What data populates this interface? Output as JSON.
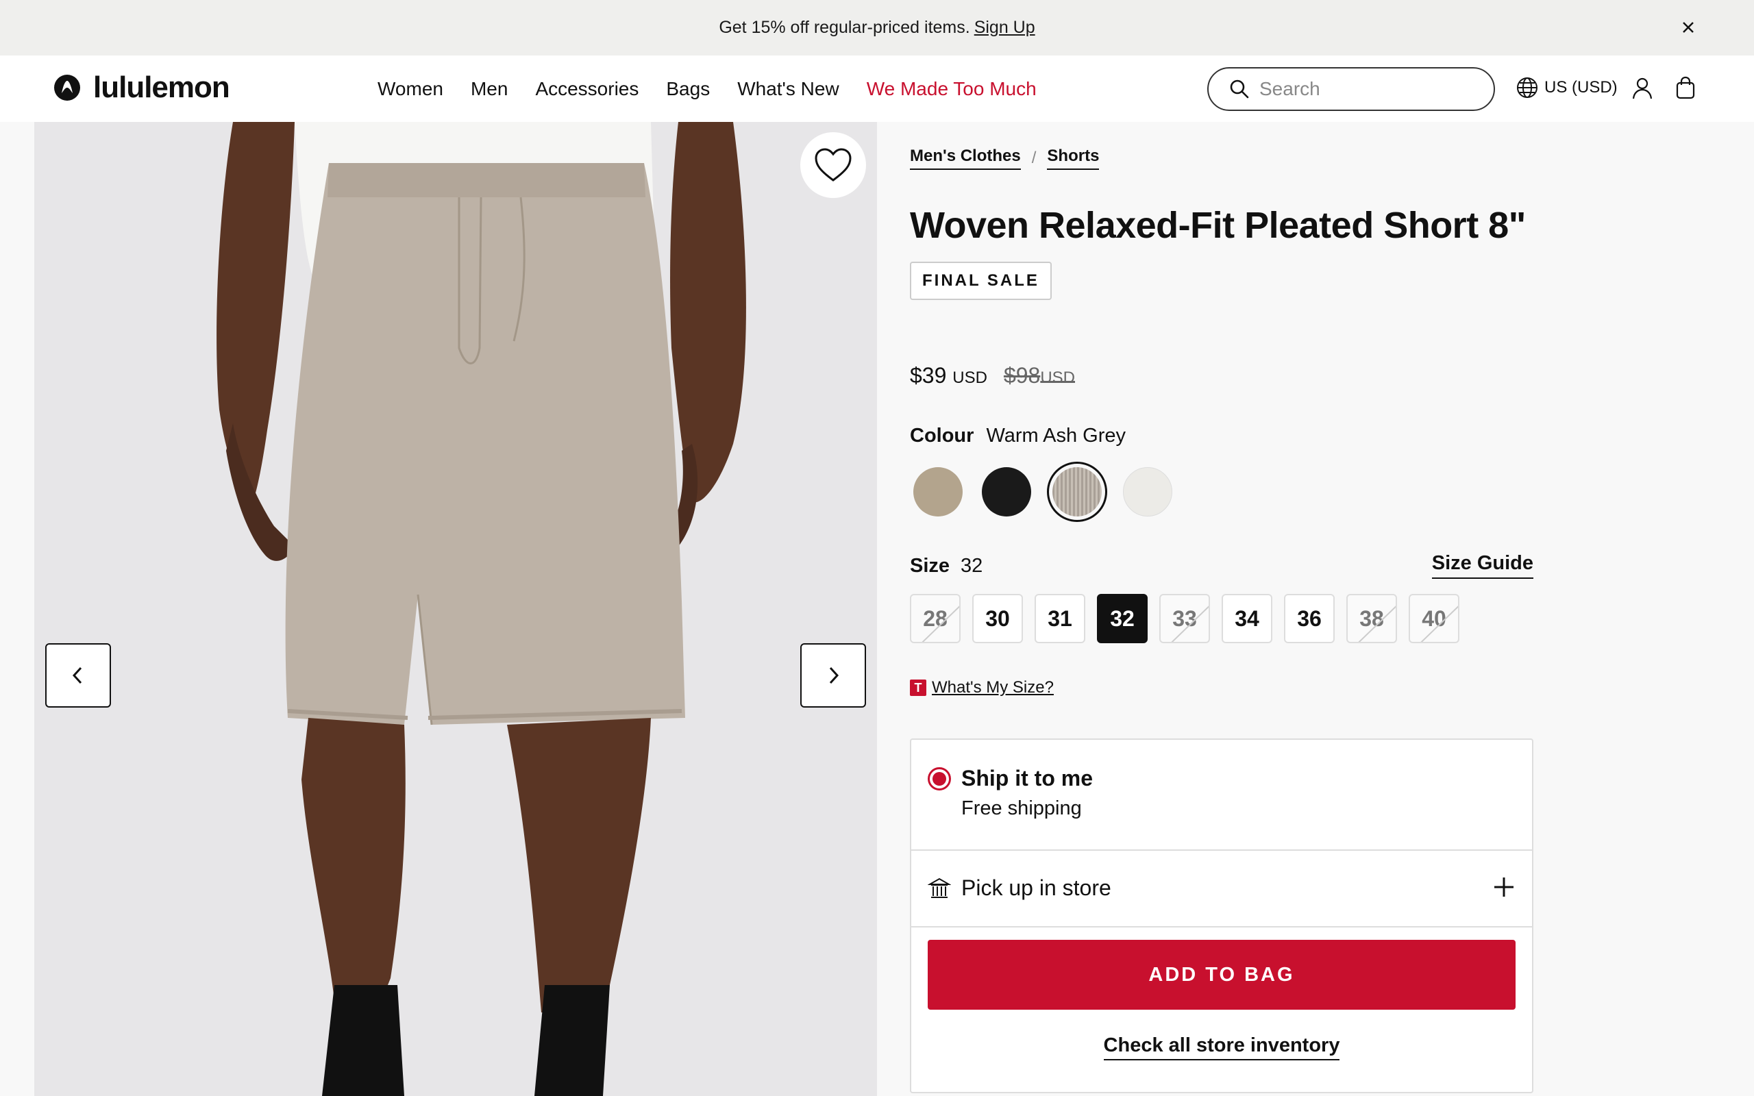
{
  "promo": {
    "text": "Get 15% off regular-priced items.",
    "link": "Sign Up"
  },
  "header": {
    "brand": "lululemon",
    "nav": [
      "Women",
      "Men",
      "Accessories",
      "Bags",
      "What's New",
      "We Made Too Much"
    ],
    "search_placeholder": "Search",
    "locale": "US (USD)"
  },
  "product": {
    "breadcrumb": [
      "Men's Clothes",
      "Shorts"
    ],
    "title": "Woven Relaxed-Fit Pleated Short 8\"",
    "badge": "FINAL SALE",
    "price": {
      "current": "$39",
      "current_currency": "USD",
      "original": "$98",
      "original_currency": "USD"
    },
    "colour_label": "Colour",
    "colour_value": "Warm Ash Grey",
    "swatches": [
      {
        "color": "#b3a48d",
        "selected": false
      },
      {
        "color": "#1a1a1a",
        "selected": false
      },
      {
        "color": "#a9a097",
        "selected": true
      },
      {
        "color": "#ecebe7",
        "selected": false
      }
    ],
    "size_label": "Size",
    "size_value": "32",
    "size_guide": "Size Guide",
    "sizes": [
      {
        "label": "28",
        "available": false
      },
      {
        "label": "30",
        "available": true
      },
      {
        "label": "31",
        "available": true
      },
      {
        "label": "32",
        "available": true,
        "selected": true
      },
      {
        "label": "33",
        "available": false
      },
      {
        "label": "34",
        "available": true
      },
      {
        "label": "36",
        "available": true
      },
      {
        "label": "38",
        "available": false
      },
      {
        "label": "40",
        "available": false
      }
    ],
    "whats_my_size": "What's My Size?",
    "whats_my_size_icon": "T",
    "ship_title": "Ship it to me",
    "ship_sub": "Free shipping",
    "pickup": "Pick up in store",
    "add_to_bag": "ADD TO BAG",
    "check_inventory": "Check all store inventory"
  },
  "colors": {
    "accent_red": "#c8102e",
    "gallery_bg": "#e7e6e8"
  }
}
